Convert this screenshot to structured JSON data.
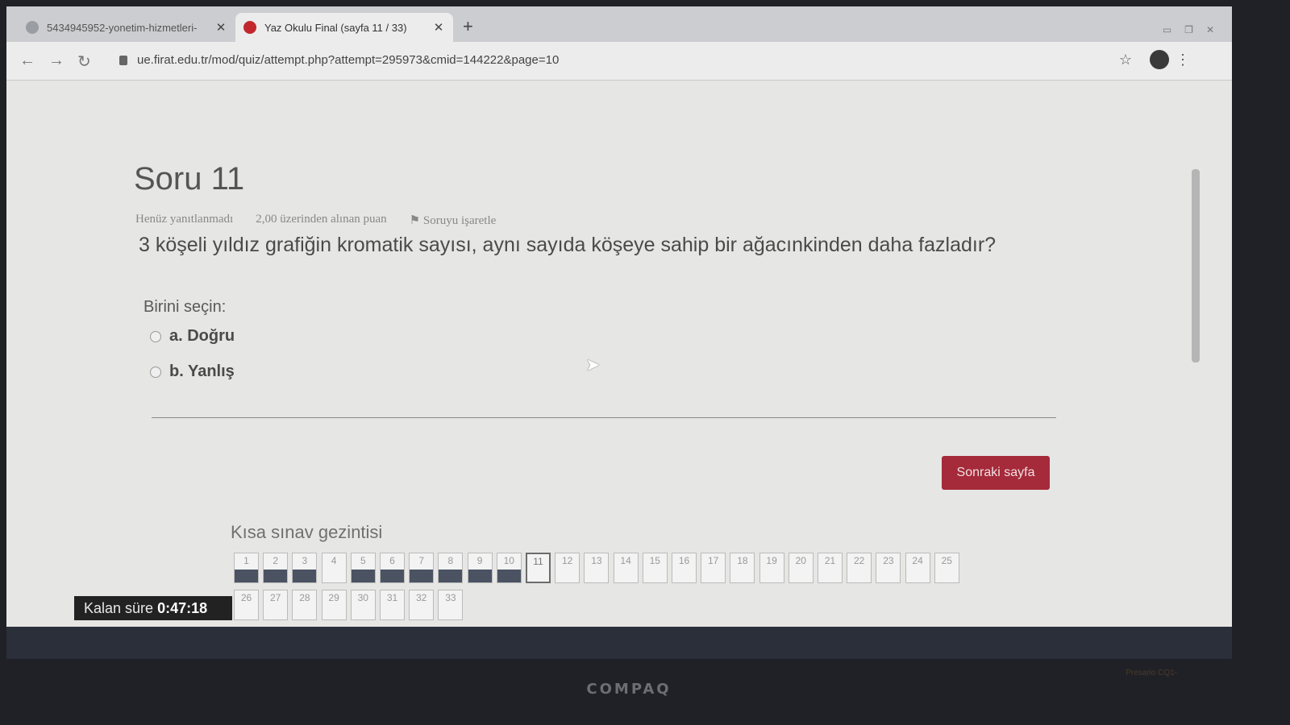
{
  "browser": {
    "tabs": [
      {
        "title": "5434945952-yonetim-hizmetleri-",
        "active": false
      },
      {
        "title": "Yaz Okulu Final (sayfa 11 / 33)",
        "active": true
      }
    ],
    "new_tab": "+",
    "close_glyph": "✕",
    "back_glyph": "←",
    "forward_glyph": "→",
    "reload_glyph": "↻",
    "url": "ue.firat.edu.tr/mod/quiz/attempt.php?attempt=295973&cmid=144222&page=10",
    "star_glyph": "☆",
    "menu_glyph": "⋮"
  },
  "quiz": {
    "question_number": "Soru 11",
    "status": "Henüz yanıtlanmadı",
    "points": "2,00 üzerinden alınan puan",
    "flag": "Soruyu işaretle",
    "question_text": "3 köşeli yıldız grafiğin kromatik sayısı, aynı sayıda köşeye sahip bir ağacınkinden daha fazladır?",
    "prompt": "Birini seçin:",
    "options": [
      "a. Doğru",
      "b. Yanlış"
    ],
    "next_button": "Sonraki sayfa",
    "nav_title": "Kısa sınav gezintisi",
    "timer_label": "Kalan süre",
    "timer_value": "0:47:18",
    "current_page": 11,
    "answered_pages": [
      1,
      2,
      3,
      5,
      6,
      7,
      8,
      9,
      10
    ],
    "total_pages": 33
  },
  "device": {
    "brand": "COMPAQ",
    "model": "Presario CQ1-"
  },
  "colors": {
    "accent": "#a52a3a",
    "answered": "#4b5363"
  },
  "icons": [
    "back-icon",
    "forward-icon",
    "reload-icon",
    "lock-icon",
    "star-icon",
    "profile-icon",
    "menu-icon",
    "flag-icon"
  ]
}
